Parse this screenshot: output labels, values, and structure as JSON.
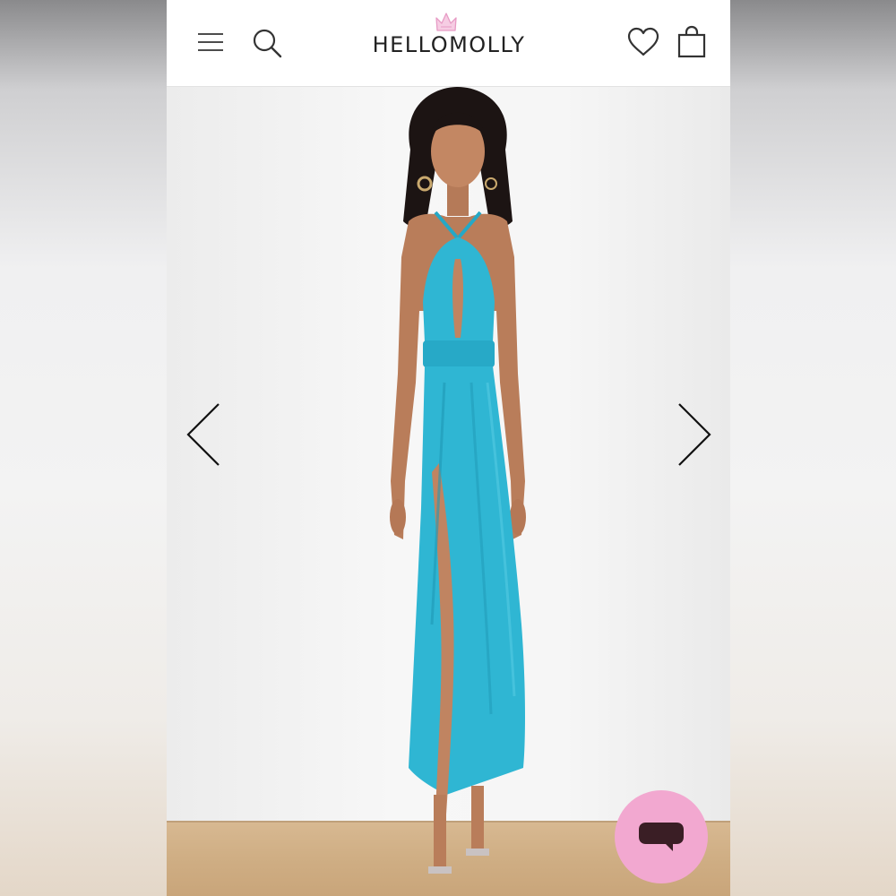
{
  "header": {
    "brand": "HELLOMOLLY",
    "menu_icon": "hamburger-menu-icon",
    "search_icon": "search-icon",
    "wishlist_icon": "heart-icon",
    "bag_icon": "shopping-bag-icon"
  },
  "gallery": {
    "image_subject": "product-photo",
    "prev_icon": "chevron-left-icon",
    "next_icon": "chevron-right-icon"
  },
  "chat": {
    "icon": "chat-icon"
  },
  "colors": {
    "header_bg": "#ffffff",
    "logo_crown": "#e79bc5",
    "dress": "#2fb6d3",
    "chat_bubble": "#f2a8d0",
    "chat_icon": "#3a1e25"
  }
}
